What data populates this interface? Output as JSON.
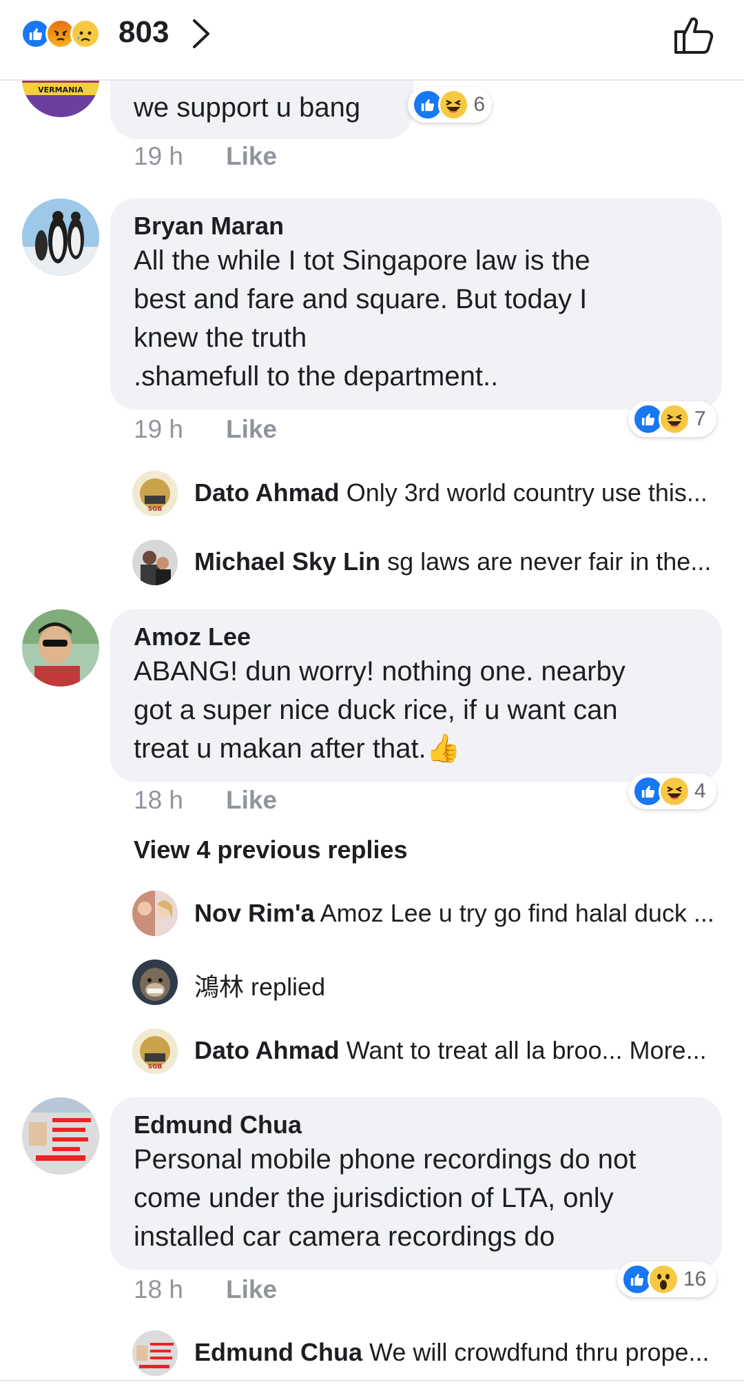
{
  "header": {
    "reaction_count": "803",
    "reactions": [
      "like-icon",
      "angry-icon",
      "sad-icon"
    ]
  },
  "comments": [
    {
      "text": "we support u bang",
      "time": "19 h",
      "like_label": "Like",
      "reaction_count": "6"
    },
    {
      "name": "Bryan Maran",
      "text": "All the while I tot Singapore law is the\nbest and fare and square. But today I\nknew the truth\n.shamefull to the department..",
      "time": "19 h",
      "like_label": "Like",
      "reaction_count": "7",
      "replies": [
        {
          "name": "Dato Ahmad",
          "text": "Only 3rd world country use this..."
        },
        {
          "name": "Michael Sky Lin",
          "text": "sg laws are never fair in the..."
        }
      ]
    },
    {
      "name": "Amoz Lee",
      "text": "ABANG! dun worry! nothing one. nearby\ngot a super nice duck rice, if u want can\ntreat u makan after that.",
      "emoji": "👍",
      "time": "18 h",
      "like_label": "Like",
      "reaction_count": "4",
      "view_previous": "View 4 previous replies",
      "replies": [
        {
          "name": "Nov Rim'a",
          "text": "Amoz Lee u try go find halal duck ..."
        },
        {
          "name": "鴻林",
          "text": "replied"
        },
        {
          "name": "Dato Ahmad",
          "text": "Want to treat all la broo... More..."
        }
      ]
    },
    {
      "name": "Edmund Chua",
      "text": "Personal mobile phone recordings do not\ncome under the jurisdiction of LTA, only\ninstalled car camera recordings do",
      "time": "18 h",
      "like_label": "Like",
      "reaction_count": "16",
      "replies": [
        {
          "name": "Edmund Chua",
          "text": "We will crowdfund thru prope..."
        }
      ]
    }
  ],
  "colors": {
    "like_blue": "#1877f2",
    "bubble_bg": "#f0f2f5",
    "meta_gray": "#90949c"
  }
}
